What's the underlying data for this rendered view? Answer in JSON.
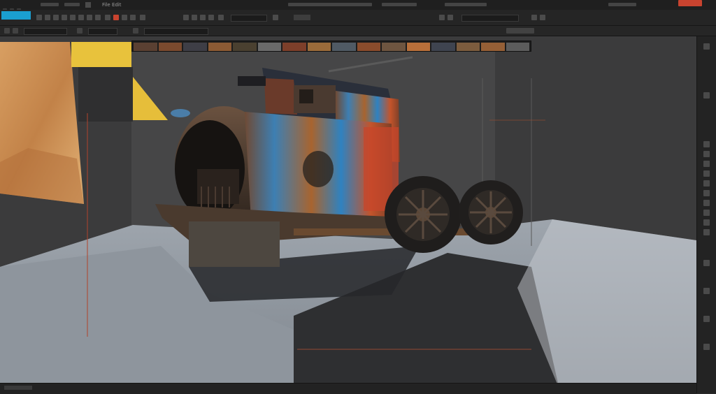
{
  "app": {
    "accent_color": "#1a9fd0",
    "close_color": "#c8432f"
  },
  "menubar": {
    "items": [
      "File Edit"
    ],
    "icons": [
      "app-menu-icon",
      "window-icon",
      "window-icon"
    ]
  },
  "viewport": {
    "scene_object": "rusty-steam-wagon",
    "backdrop_colors": [
      "#c9935a",
      "#e8b83a",
      "#8a8f96",
      "#3a3a3a"
    ]
  },
  "filmstrip": {
    "thumb_colors": [
      "#5a4032",
      "#7a4a2e",
      "#3e3e46",
      "#8b5a34",
      "#4a4030",
      "#6a6a6a",
      "#7d3f2a",
      "#9a6b3a",
      "#505a64",
      "#8a4c2c",
      "#6e5540",
      "#b86f3a",
      "#3f4450",
      "#7c5c3e",
      "#955f36",
      "#5c5c5c"
    ]
  }
}
